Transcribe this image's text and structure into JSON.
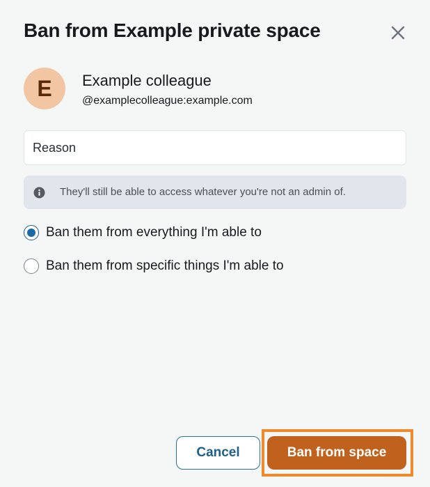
{
  "dialog": {
    "title": "Ban from Example private space",
    "close_icon": "close-icon"
  },
  "user": {
    "avatar_initial": "E",
    "avatar_color": "#f2c6a3",
    "name": "Example colleague",
    "id": "@examplecolleague:example.com"
  },
  "reason": {
    "placeholder": "Reason",
    "value": ""
  },
  "notice": {
    "icon": "info-icon",
    "text": "They'll still be able to access whatever you're not an admin of."
  },
  "options": [
    {
      "label": "Ban them from everything I'm able to",
      "selected": true
    },
    {
      "label": "Ban them from specific things I'm able to",
      "selected": false
    }
  ],
  "buttons": {
    "cancel_label": "Cancel",
    "ban_label": "Ban from space"
  },
  "colors": {
    "accent": "#1b6aa5",
    "danger": "#c0621e",
    "focus_ring": "#f08a2c"
  }
}
